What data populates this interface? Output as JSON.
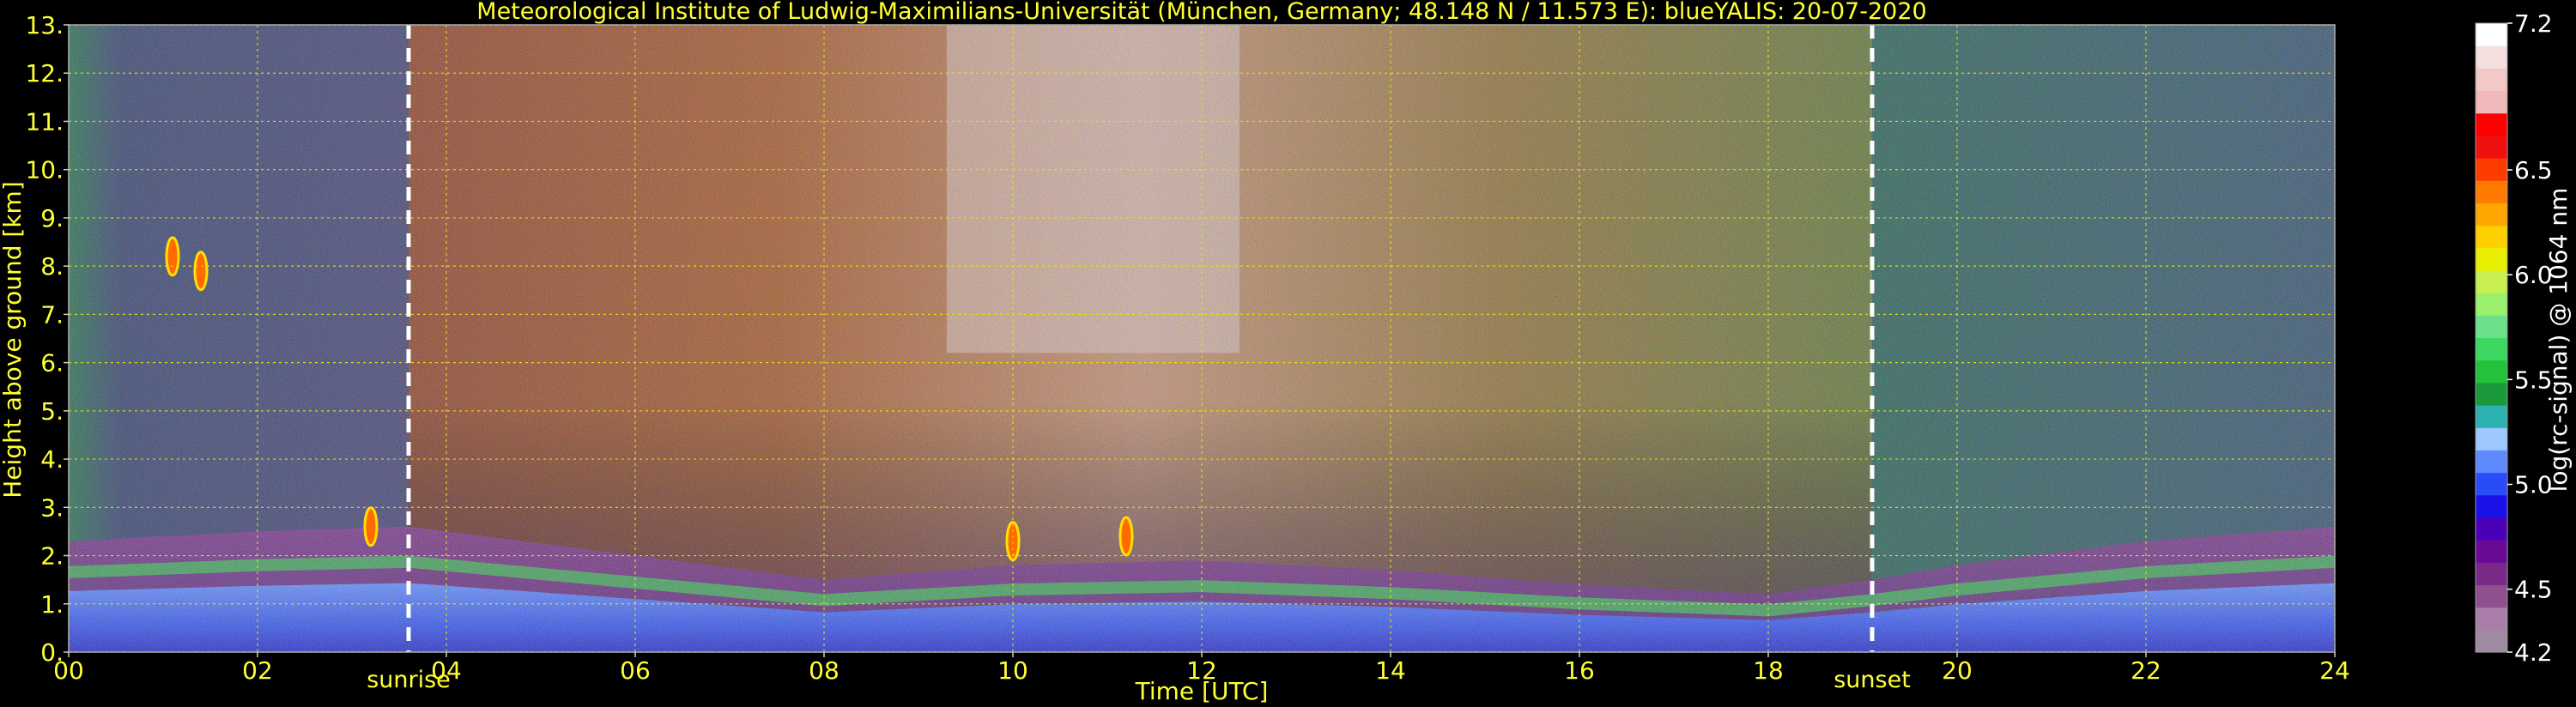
{
  "chart_data": {
    "type": "heatmap",
    "title": "Meteorological Institute of Ludwig-Maximilians-Universität (München, Germany; 48.148 N / 11.573 E):    blueYALIS: 20-07-2020",
    "xlabel": "Time [UTC]",
    "ylabel": "Height above ground [km]",
    "colorbar_label": "log(rc-signal) @ 1064 nm",
    "xlim": [
      0,
      24
    ],
    "ylim": [
      0,
      13
    ],
    "clim": [
      4.2,
      7.2
    ],
    "x_ticks": [
      0,
      2,
      4,
      6,
      8,
      10,
      12,
      14,
      16,
      18,
      20,
      22,
      24
    ],
    "x_tick_labels": [
      "00",
      "02",
      "04",
      "06",
      "08",
      "10",
      "12",
      "14",
      "16",
      "18",
      "20",
      "22",
      "24"
    ],
    "y_ticks": [
      0,
      1,
      2,
      3,
      4,
      5,
      6,
      7,
      8,
      9,
      10,
      11,
      12,
      13
    ],
    "y_tick_labels": [
      "0.",
      "1.",
      "2.",
      "3.",
      "4.",
      "5.",
      "6.",
      "7.",
      "8.",
      "9.",
      "10.",
      "11.",
      "12.",
      "13."
    ],
    "colorbar_ticks": [
      4.2,
      4.5,
      5.0,
      5.5,
      6.0,
      6.5,
      7.2
    ],
    "colorbar_tick_labels": [
      "4.2",
      "4.5",
      "5.0",
      "5.5",
      "6.0",
      "6.5",
      "7.2"
    ],
    "colorbar_colors": [
      "#a08aa0",
      "#a97ea9",
      "#8e508e",
      "#7a2a86",
      "#6a0a96",
      "#4a00b8",
      "#1a10e8",
      "#2a4cf8",
      "#5f8aff",
      "#9cc8ff",
      "#2db0b0",
      "#1a9a3a",
      "#24c23a",
      "#3ad860",
      "#6ce08a",
      "#9af06a",
      "#c8f050",
      "#e8f000",
      "#ffd000",
      "#ffa600",
      "#ff7a00",
      "#ff3c00",
      "#f01010",
      "#ff0000",
      "#f0b8b8",
      "#f2c8c8",
      "#f5dede",
      "#ffffff"
    ],
    "annotations": [
      {
        "x": 3.6,
        "label": "sunrise",
        "style": "dashed white vertical line"
      },
      {
        "x": 19.1,
        "label": "sunset",
        "style": "dashed white vertical line"
      }
    ],
    "grid": true,
    "grid_color": "yellow dotted",
    "layers": [
      {
        "description": "boundary layer top",
        "height_km_by_hour": [
          [
            0,
            2.3
          ],
          [
            2,
            2.5
          ],
          [
            3.6,
            2.6
          ],
          [
            6,
            2.0
          ],
          [
            8,
            1.5
          ],
          [
            10,
            1.8
          ],
          [
            12,
            1.9
          ],
          [
            14,
            1.7
          ],
          [
            16,
            1.4
          ],
          [
            18,
            1.2
          ],
          [
            19.1,
            1.5
          ],
          [
            20,
            1.8
          ],
          [
            22,
            2.3
          ],
          [
            24,
            2.6
          ]
        ]
      },
      {
        "description": "clouds",
        "points": [
          [
            1.1,
            8.2
          ],
          [
            1.4,
            7.9
          ],
          [
            3.2,
            2.6
          ],
          [
            10,
            2.3
          ],
          [
            11.2,
            2.4
          ]
        ]
      }
    ]
  }
}
